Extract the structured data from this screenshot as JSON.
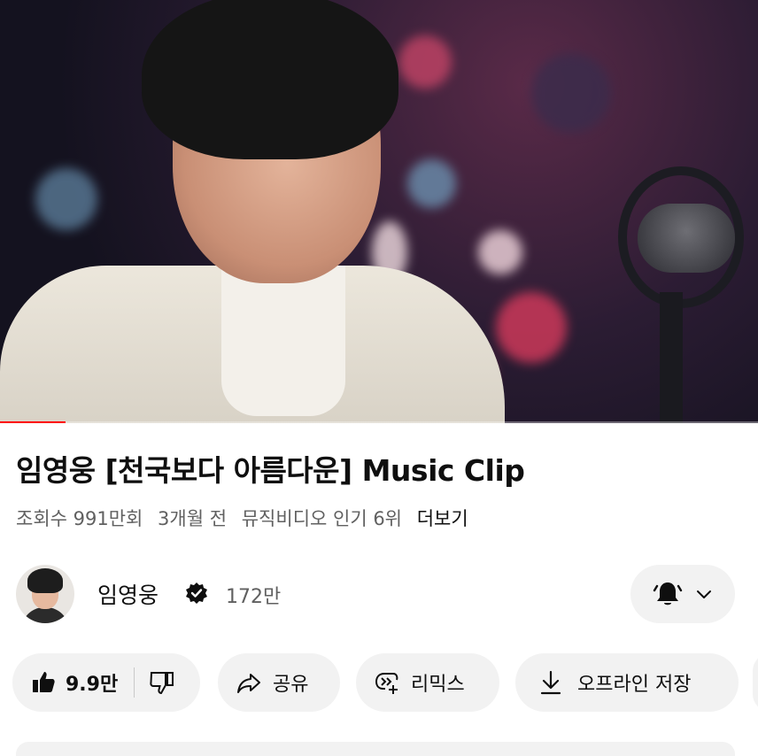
{
  "video": {
    "title": "임영웅 [천국보다 아름다운] Music Clip",
    "progress_percent": 8.7
  },
  "meta": {
    "views": "조회수 991만회",
    "age": "3개월 전",
    "ranking": "뮤직비디오 인기 6위",
    "more": "더보기"
  },
  "channel": {
    "name": "임영웅",
    "subscribers": "172만",
    "verified_icon": "verified-badge-icon",
    "bell_icon": "bell-icon"
  },
  "actions": {
    "like_count": "9.9만",
    "share": "공유",
    "remix": "리믹스",
    "offline_save": "오프라인 저장"
  },
  "colors": {
    "accent": "#ff0000",
    "pill_bg": "#f2f2f2",
    "secondary_text": "#606060"
  }
}
